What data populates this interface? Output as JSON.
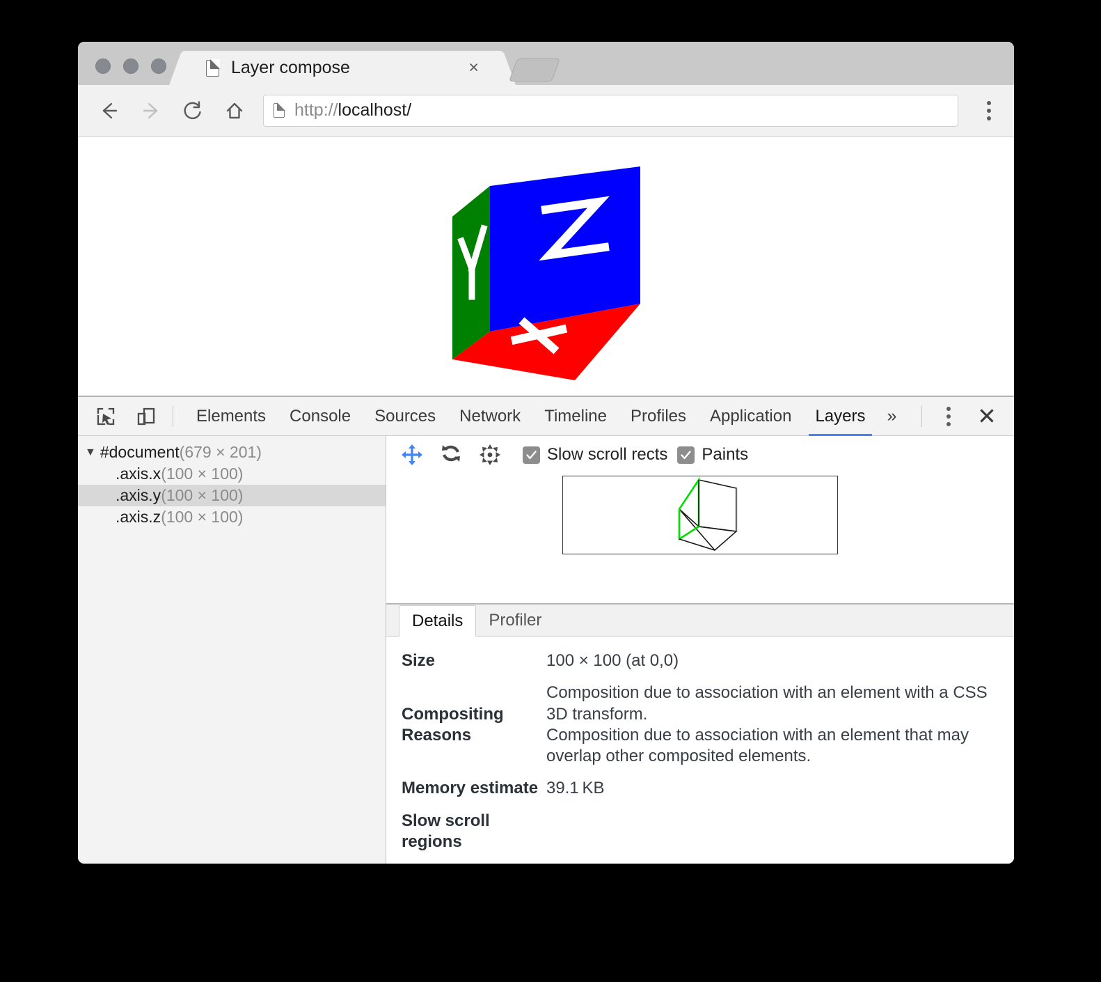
{
  "browser": {
    "tab": {
      "title": "Layer compose",
      "close_label": "×",
      "favicon": "page-icon"
    },
    "newtab_label": "",
    "nav": {
      "back": "back-arrow",
      "forward": "forward-arrow",
      "reload": "reload-icon",
      "home": "home-icon"
    },
    "omnibox": {
      "scheme": "http://",
      "host": "localhost/",
      "full_url": "http://localhost/"
    },
    "menu_label": "browser-menu"
  },
  "page": {
    "cube": {
      "faces": [
        {
          "axis": "Y",
          "color": "#008000",
          "label": "Y"
        },
        {
          "axis": "Z",
          "color": "#0000ff",
          "label": "Z"
        },
        {
          "axis": "X",
          "color": "#ff0000",
          "label": "X"
        }
      ]
    }
  },
  "devtools": {
    "tabs": [
      {
        "label": "Elements",
        "active": false
      },
      {
        "label": "Console",
        "active": false
      },
      {
        "label": "Sources",
        "active": false
      },
      {
        "label": "Network",
        "active": false
      },
      {
        "label": "Timeline",
        "active": false
      },
      {
        "label": "Profiles",
        "active": false
      },
      {
        "label": "Application",
        "active": false
      },
      {
        "label": "Layers",
        "active": true
      }
    ],
    "more_label": "»",
    "close_label": "✕",
    "tree": {
      "root": {
        "arrow": "▼",
        "name": "#document",
        "dimensions": "(679 × 201)"
      },
      "children": [
        {
          "name": ".axis.x",
          "dimensions": "(100 × 100)",
          "selected": false
        },
        {
          "name": ".axis.y",
          "dimensions": "(100 × 100)",
          "selected": true
        },
        {
          "name": ".axis.z",
          "dimensions": "(100 × 100)",
          "selected": false
        }
      ]
    },
    "layers_toolbar": {
      "pan_icon": "pan-move-icon",
      "rotate_icon": "rotate-icon",
      "reset_icon": "center-reset-icon",
      "checkboxes": [
        {
          "label": "Slow scroll rects",
          "checked": true
        },
        {
          "label": "Paints",
          "checked": true
        }
      ]
    },
    "drawer": {
      "tabs": [
        {
          "label": "Details",
          "active": true
        },
        {
          "label": "Profiler",
          "active": false
        }
      ],
      "details": [
        {
          "key": "Size",
          "value": "100 × 100 (at 0,0)"
        },
        {
          "key": "Compositing Reasons",
          "value": "Composition due to association with an element with a CSS 3D transform.\nComposition due to association with an element that may overlap other composited elements."
        },
        {
          "key": "Memory estimate",
          "value": "39.1 KB"
        },
        {
          "key": "Slow scroll regions",
          "value": ""
        }
      ]
    }
  },
  "colors": {
    "accent": "#4285f4",
    "axis_x": "#ff0000",
    "axis_y": "#008000",
    "axis_z": "#0000ff",
    "preview_highlight": "#00e000"
  }
}
